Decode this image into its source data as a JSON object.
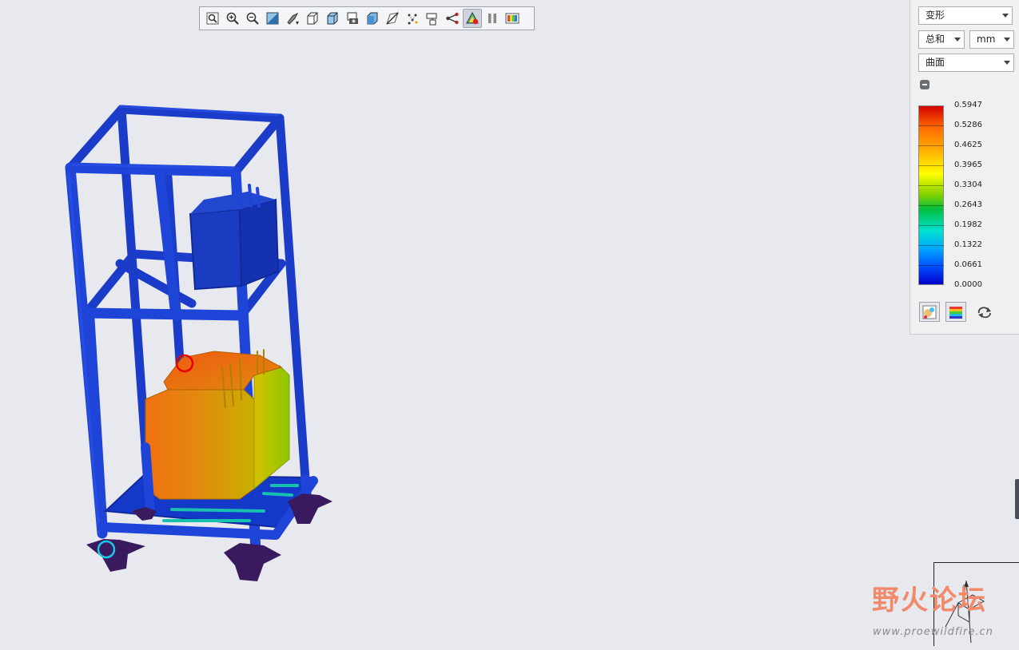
{
  "toolbar": {
    "buttons": [
      {
        "name": "refit-icon"
      },
      {
        "name": "zoom-in-icon"
      },
      {
        "name": "zoom-out-icon"
      },
      {
        "name": "repaint-icon"
      },
      {
        "name": "orient-icon"
      },
      {
        "name": "saved-views-icon"
      },
      {
        "name": "display-style-icon"
      },
      {
        "name": "snapshot-icon"
      },
      {
        "name": "view-manager-icon"
      },
      {
        "name": "cut-plane-icon"
      },
      {
        "name": "query-icon"
      },
      {
        "name": "sensor-icon"
      },
      {
        "name": "connections-icon"
      },
      {
        "name": "animate-icon",
        "active": true
      },
      {
        "name": "pause-icon"
      },
      {
        "name": "legend-icon"
      }
    ]
  },
  "panel": {
    "result_type": "变形",
    "component": "总和",
    "unit": "mm",
    "display": "曲面",
    "legend": {
      "values": [
        "0.5947",
        "0.5286",
        "0.4625",
        "0.3965",
        "0.3304",
        "0.2643",
        "0.1982",
        "0.1322",
        "0.0661",
        "0.0000"
      ],
      "colors": [
        "#d40000",
        "#ff6a00",
        "#ffb000",
        "#ffff00",
        "#7ed000",
        "#00c040",
        "#00e0d0",
        "#00a8ff",
        "#0050ff",
        "#0000c8"
      ]
    },
    "buttons": [
      {
        "name": "contour-icon"
      },
      {
        "name": "color-scale-icon"
      },
      {
        "name": "reverse-icon"
      }
    ]
  },
  "markers": {
    "max_color": "#e60000",
    "min_color": "#18c8e8"
  },
  "watermark": {
    "title": "野火论坛",
    "url": "www.proewildfire.cn"
  },
  "triad": {
    "axis_label": "Y"
  }
}
